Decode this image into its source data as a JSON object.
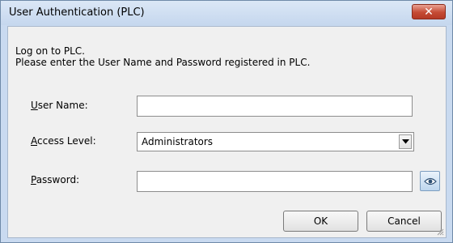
{
  "window": {
    "title": "User Authentication (PLC)",
    "close_label": "✕"
  },
  "message": {
    "line1": "Log on to PLC.",
    "line2": "Please enter the User Name and Password registered in PLC."
  },
  "form": {
    "user_name": {
      "label_key": "U",
      "label_rest": "ser Name:",
      "value": ""
    },
    "access_level": {
      "label_key": "A",
      "label_rest": "ccess Level:",
      "value": "Administrators"
    },
    "password": {
      "label_key": "P",
      "label_rest": "assword:",
      "value": ""
    }
  },
  "buttons": {
    "ok": "OK",
    "cancel": "Cancel"
  },
  "icons": {
    "close": "close-icon",
    "dropdown": "chevron-down-icon",
    "show_password": "eye-icon"
  },
  "colors": {
    "close_button": "#c54a34",
    "title_bar": "#c9daf0",
    "client_bg": "#f0f0f0"
  }
}
